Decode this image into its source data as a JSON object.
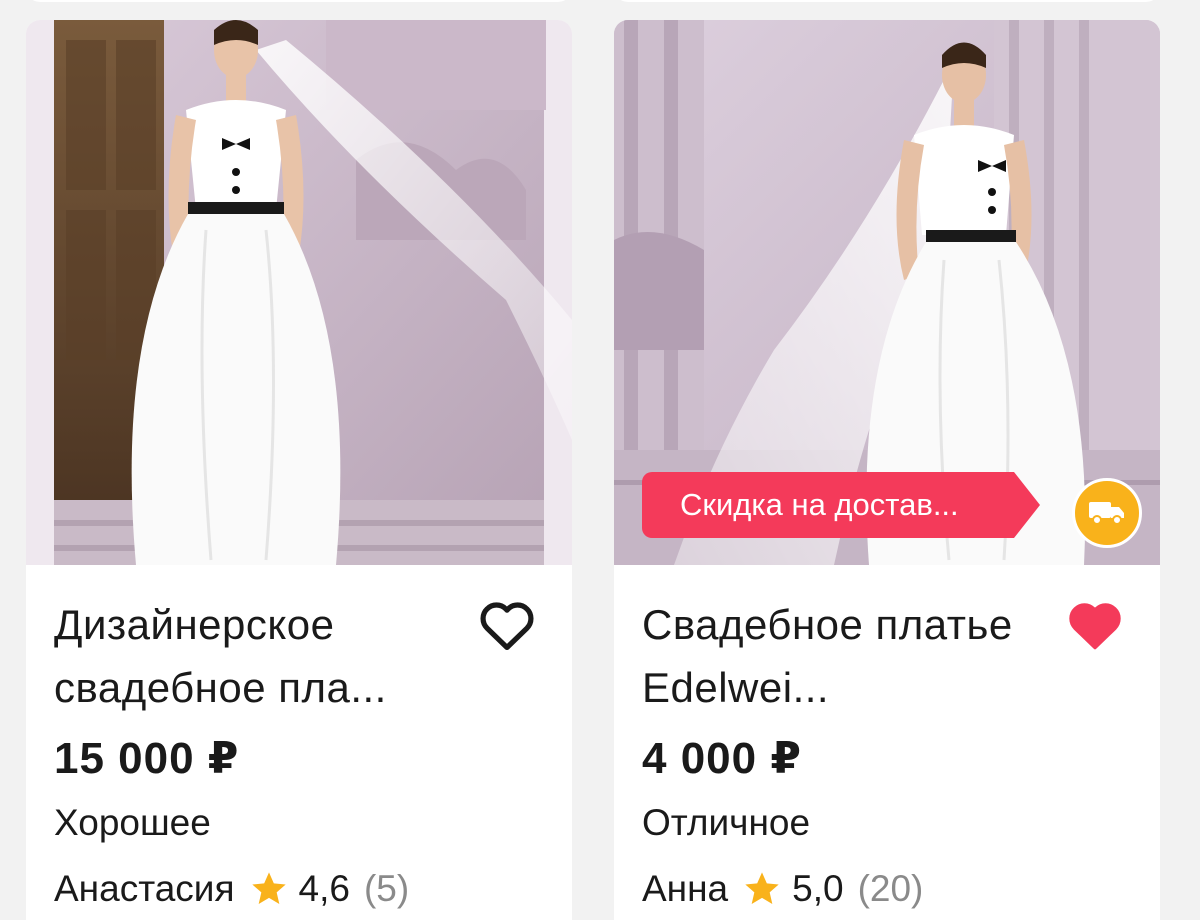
{
  "cards": [
    {
      "title": "Дизайнерское свадебное пла...",
      "price": "15 000 ₽",
      "condition": "Хорошее",
      "seller": "Анастасия",
      "rating": "4,6",
      "reviews": "(5)",
      "favorited": false,
      "icons": {
        "favorite": "heart-outline-icon",
        "rating": "star-icon"
      }
    },
    {
      "title": "Свадебное платье Edelwei...",
      "price": "4 000 ₽",
      "condition": "Отличное",
      "seller": "Анна",
      "rating": "5,0",
      "reviews": "(20)",
      "favorited": true,
      "promo_badge": "Скидка на достав...",
      "icons": {
        "favorite": "heart-filled-icon",
        "rating": "star-icon",
        "delivery": "truck-icon"
      }
    }
  ],
  "colors": {
    "accent_red": "#f43a5a",
    "star_yellow": "#f9b21b",
    "muted_text": "#8a8a8a"
  }
}
